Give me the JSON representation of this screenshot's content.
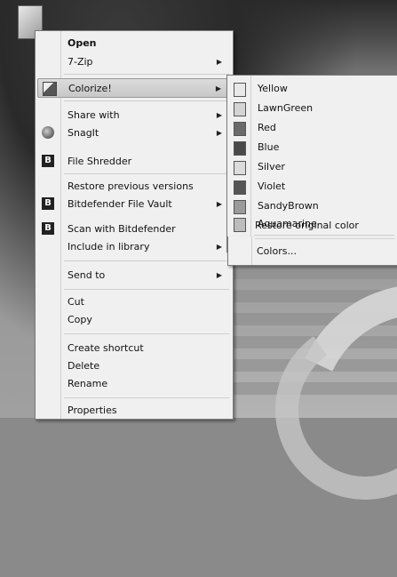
{
  "context_menu": {
    "items": [
      {
        "label": "Open",
        "bold": true,
        "submenu": false
      },
      {
        "label": "7-Zip",
        "submenu": true
      },
      {
        "label": "Colorize!",
        "submenu": true,
        "icon": "colorize-icon"
      },
      {
        "label": "Share with",
        "submenu": true
      },
      {
        "label": "SnagIt",
        "submenu": true,
        "icon": "snagit-icon"
      },
      {
        "label": "File Shredder",
        "submenu": false,
        "icon": "bitdefender-icon"
      },
      {
        "label": "Restore previous versions",
        "submenu": false
      },
      {
        "label": "Bitdefender File Vault",
        "submenu": true,
        "icon": "bitdefender-icon"
      },
      {
        "label": "Scan with Bitdefender",
        "submenu": false,
        "icon": "bitdefender-icon"
      },
      {
        "label": "Include in library",
        "submenu": true
      },
      {
        "label": "Send to",
        "submenu": true
      },
      {
        "label": "Cut",
        "submenu": false
      },
      {
        "label": "Copy",
        "submenu": false
      },
      {
        "label": "Create shortcut",
        "submenu": false
      },
      {
        "label": "Delete",
        "submenu": false
      },
      {
        "label": "Rename",
        "submenu": false
      },
      {
        "label": "Properties",
        "submenu": false
      }
    ]
  },
  "colorize_submenu": {
    "colors": [
      "Yellow",
      "LawnGreen",
      "Red",
      "Blue",
      "Silver",
      "Violet",
      "SandyBrown",
      "Aquamarine"
    ],
    "restore_label": "Restore original color",
    "more_label": "Colors..."
  }
}
